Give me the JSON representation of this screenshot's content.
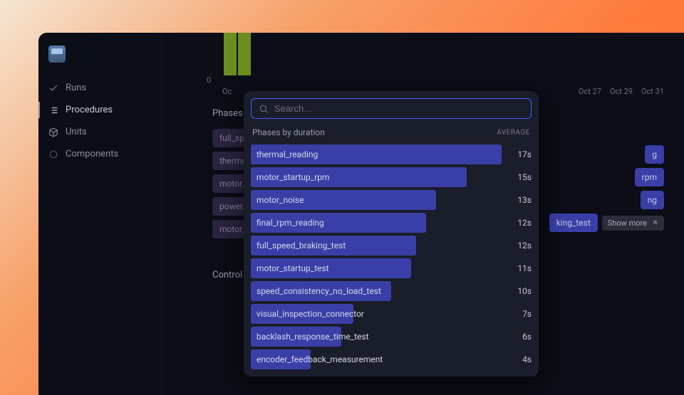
{
  "sidebar": {
    "items": [
      {
        "label": "Runs",
        "icon": "check-icon"
      },
      {
        "label": "Procedures",
        "icon": "list-icon"
      },
      {
        "label": "Units",
        "icon": "cube-icon"
      },
      {
        "label": "Components",
        "icon": "hex-icon"
      }
    ],
    "active_index": 1
  },
  "chart": {
    "y_zero": "0",
    "x_ticks": [
      "Oc",
      "Oct 27",
      "Oct 29",
      "Oct 31"
    ]
  },
  "sections": {
    "phases_by_failure_title": "Phases by fa",
    "control_chart_title": "Control Char"
  },
  "bg_pills": [
    "full_speed_l",
    "thermal_rea",
    "motor_noise",
    "power_supp",
    "motor_startu"
  ],
  "right_pills": [
    "g",
    "rpm",
    "ng",
    "king_test"
  ],
  "show_more_label": "Show more",
  "popover": {
    "search_placeholder": "Search…",
    "title": "Phases by duration",
    "right_label": "AVERAGE",
    "rows": [
      {
        "label": "thermal_reading",
        "duration": "17s",
        "pct": 100
      },
      {
        "label": "motor_startup_rpm",
        "duration": "15s",
        "pct": 86
      },
      {
        "label": "motor_noise",
        "duration": "13s",
        "pct": 74
      },
      {
        "label": "final_rpm_reading",
        "duration": "12s",
        "pct": 70
      },
      {
        "label": "full_speed_braking_test",
        "duration": "12s",
        "pct": 66
      },
      {
        "label": "motor_startup_test",
        "duration": "11s",
        "pct": 64
      },
      {
        "label": "speed_consistency_no_load_test",
        "duration": "10s",
        "pct": 56
      },
      {
        "label": "visual_inspection_connector",
        "duration": "7s",
        "pct": 41
      },
      {
        "label": "backlash_response_time_test",
        "duration": "6s",
        "pct": 36
      },
      {
        "label": "encoder_feedback_measurement",
        "duration": "4s",
        "pct": 24
      }
    ]
  },
  "chart_data": {
    "type": "bar",
    "title": "Phases by duration",
    "xlabel": "",
    "ylabel": "AVERAGE",
    "categories": [
      "thermal_reading",
      "motor_startup_rpm",
      "motor_noise",
      "final_rpm_reading",
      "full_speed_braking_test",
      "motor_startup_test",
      "speed_consistency_no_load_test",
      "visual_inspection_connector",
      "backlash_response_time_test",
      "encoder_feedback_measurement"
    ],
    "values": [
      17,
      15,
      13,
      12,
      12,
      11,
      10,
      7,
      6,
      4
    ],
    "ylim": [
      0,
      17
    ]
  }
}
